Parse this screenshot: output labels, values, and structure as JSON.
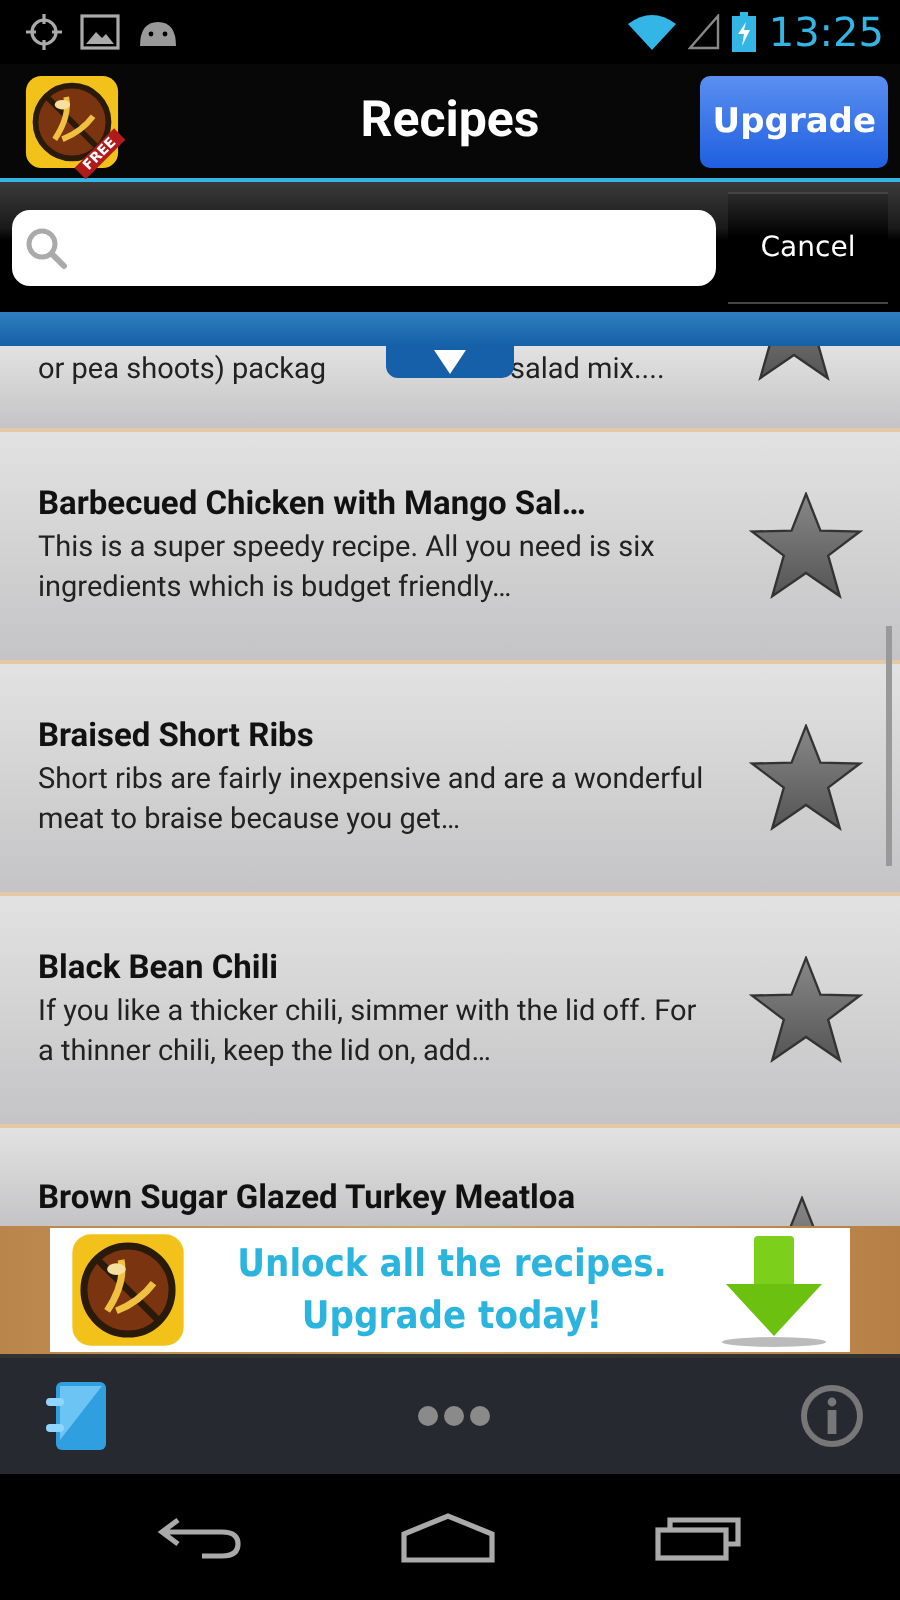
{
  "status_bar": {
    "time": "13:25"
  },
  "header": {
    "title": "Recipes",
    "upgrade_button": "Upgrade",
    "badge": "FREE"
  },
  "search": {
    "cancel": "Cancel"
  },
  "partial_top": {
    "text_before": "or pea shoots) packag",
    "text_after": "salad mix....",
    "favorite": false
  },
  "recipes": [
    {
      "title": "Barbecued Chicken with Mango Sal…",
      "description": "This is a super speedy recipe. All you need is six ingredients which is budget friendly…",
      "favorite": false
    },
    {
      "title": "Braised Short Ribs",
      "description": "Short ribs are fairly inexpensive and are a wonderful meat to braise because you get…",
      "favorite": false
    },
    {
      "title": "Black Bean Chili",
      "description": "If you like a thicker chili, simmer with the lid off.  For a thinner chili, keep the lid on, add…",
      "favorite": false
    }
  ],
  "partial_bottom": {
    "title": "Brown Sugar Glazed Turkey Meatloa",
    "favorite": false
  },
  "ad": {
    "line1": "Unlock all the recipes.",
    "line2": "Upgrade today!"
  }
}
